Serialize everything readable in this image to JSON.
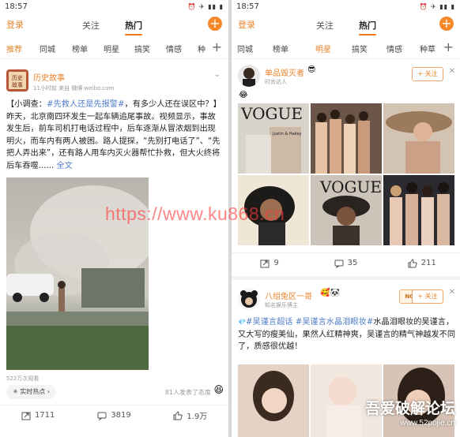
{
  "colors": {
    "accent": "#e8842a",
    "link": "#4f7cc7",
    "muted": "#999999",
    "watermark": "#ff3b3b"
  },
  "left": {
    "status": {
      "time": "18:57"
    },
    "nav": {
      "login": "登录",
      "tabs": [
        "关注",
        "热门"
      ],
      "active_tab": "热门"
    },
    "categories": [
      "推荐",
      "同城",
      "榜单",
      "明星",
      "搞笑",
      "情感",
      "种"
    ],
    "post": {
      "author": "历史故事",
      "meta": "11小时前  来自 微博 weibo.com",
      "text_parts": {
        "p1": "【小调查：",
        "p2": "#先救人还是先报警#",
        "p3": "，有多少人还在误区中？】昨天，北京南四环发生一起车辆追尾事故。视频显示，事故发生后，前车司机打电话过程中，后车逐渐从冒浓烟到出现明火，而车内有两人被困。路人提探，“先别打电话了”、“先把人弄出来”，还有路人用车内灭火器帮忙扑救，但大火终将后车吞噬......",
        "p4": "全文"
      },
      "views": "522万次观看",
      "hot_label": "实时热点",
      "hot_arrow": "›",
      "reactions": "81人发表了态度",
      "actions": {
        "repost": "1711",
        "comment": "3819",
        "like": "1.9万"
      }
    }
  },
  "right": {
    "status": {
      "time": "18:57"
    },
    "nav": {
      "login": "登录",
      "tabs": [
        "关注",
        "热门"
      ],
      "active_tab": "热门"
    },
    "categories": [
      "同城",
      "榜单",
      "明星",
      "搞笑",
      "情感",
      "种草"
    ],
    "active_category": "明星",
    "post1": {
      "author": "单品毁灭者",
      "meta": "时尚达人",
      "follow": "+ 关注",
      "magazine_1": "VOGUE",
      "magazine_1_sub": "Justin & Hailey",
      "magazine_2": "VOGUE",
      "actions": {
        "repost": "9",
        "comment": "35",
        "like": "211"
      }
    },
    "post2": {
      "author": "八组兔区一哥",
      "meta": "知名娱乐博主",
      "follow": "+ 关注",
      "badge": "NO.1",
      "text_parts": {
        "t1": "#吴谨言超话",
        "t2": " ",
        "t3": "#吴谨言水晶泪眼妆#",
        "t4": "水晶泪眼妆的吴谨言，又大写的瘦美仙，果然人红精神爽，吴谨言的精气神越发不同了，质感很优越！"
      }
    }
  },
  "overlay": {
    "watermark": "https://www.ku868.cn",
    "brand_title": "吾爱破解论坛",
    "brand_url": "www.52pojie.cn"
  }
}
